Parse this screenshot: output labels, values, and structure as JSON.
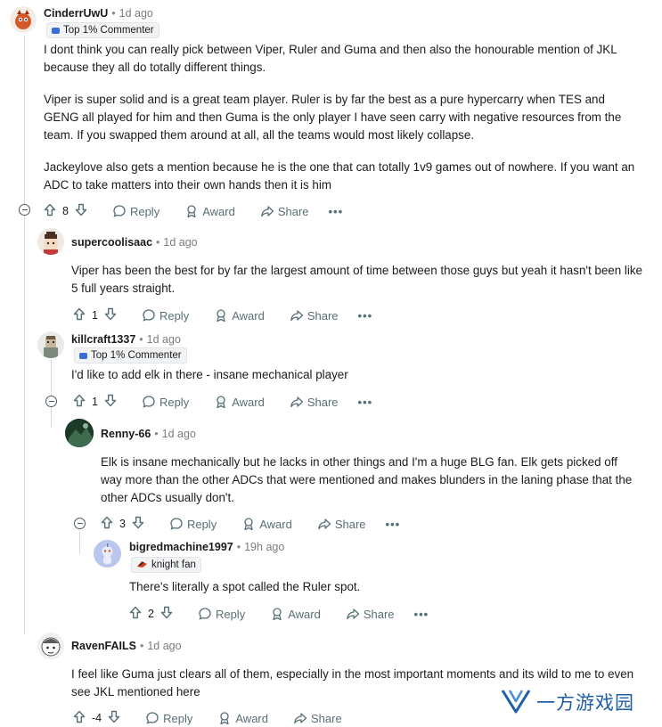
{
  "labels": {
    "reply": "Reply",
    "award": "Award",
    "share": "Share",
    "more": "•••",
    "dot": "•"
  },
  "comments": [
    {
      "username": "CinderrUwU",
      "time": "1d ago",
      "badge": "Top 1% Commenter",
      "score": "8",
      "paragraphs": [
        "I dont think you can really pick between Viper, Ruler and Guma and then also the honourable mention of JKL because they all do totally different things.",
        "Viper is super solid and is a great team player. Ruler is by far the best as a pure hypercarry when TES and GENG all played for him and then Guma is the only player I have seen carry with negative resources from the team. If you swapped them around at all, all the teams would most likely collapse.",
        "Jackeylove also gets a mention because he is the one that can totally 1v9 games out of nowhere. If you want an ADC to take matters into their own hands then it is him"
      ]
    },
    {
      "username": "supercoolisaac",
      "time": "1d ago",
      "score": "1",
      "text": "Viper has been the best for by far the largest amount of time between those guys but yeah it hasn't been like 5 full years straight."
    },
    {
      "username": "killcraft1337",
      "time": "1d ago",
      "badge": "Top 1% Commenter",
      "score": "1",
      "text": "I'd like to add elk in there - insane mechanical player"
    },
    {
      "username": "Renny-66",
      "time": "1d ago",
      "score": "3",
      "text": "Elk is insane mechanically but he lacks in other things and I'm a huge BLG fan. Elk gets picked off way more than the other ADCs that were mentioned and makes blunders in the laning phase that the other ADCs usually don't."
    },
    {
      "username": "bigredmachine1997",
      "time": "19h ago",
      "flair": "knight fan",
      "score": "2",
      "text": "There's literally a spot called the Ruler spot."
    },
    {
      "username": "RavenFAILS",
      "time": "1d ago",
      "score": "-4",
      "text": "I feel like Guma just clears all of them, especially in the most important moments and its wild to me to even see JKL mentioned here"
    }
  ],
  "watermark": {
    "text": "一方游戏园"
  },
  "colors": {
    "accent": "#1f5ea8",
    "meta": "#576f76",
    "badge_icon": "#3b6fd8"
  }
}
